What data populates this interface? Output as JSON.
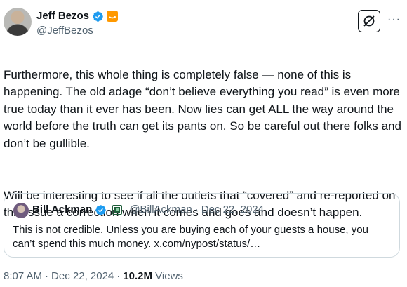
{
  "author": {
    "name": "Jeff Bezos",
    "handle": "@JeffBezos"
  },
  "tweet": {
    "paragraph_1": "Furthermore, this whole thing is completely false — none of this is happening. The old adage “don’t believe everything you read” is even more true today than it ever has been. Now lies can get ALL the way around the world before the truth can get its pants on. So be careful out there folks and don’t be gullible.",
    "paragraph_2": "Will be interesting to see if all the outlets that “covered” and re-reported on this issue a correction when it comes and goes and doesn’t happen."
  },
  "quote": {
    "name": "Bill Ackman",
    "handle": "@BillAckman",
    "separator": "·",
    "date": "Dec 22, 2024",
    "text": "This is not credible. Unless you are buying each of your guests a house, you can’t spend this much money. x.com/nypost/status/…"
  },
  "footer": {
    "time": "8:07 AM",
    "separator": "·",
    "date": "Dec 22, 2024",
    "separator2": "·",
    "views_count": "10.2M",
    "views_label": "Views"
  },
  "icons": {
    "verified": "verified-badge-icon",
    "amazon": "amazon-affiliate-icon",
    "grok": "grok-icon",
    "more": "more-options-icon"
  },
  "colors": {
    "verified_blue": "#1d9bf0",
    "amazon_orange": "#ff9900",
    "secondary_text": "#536471"
  }
}
